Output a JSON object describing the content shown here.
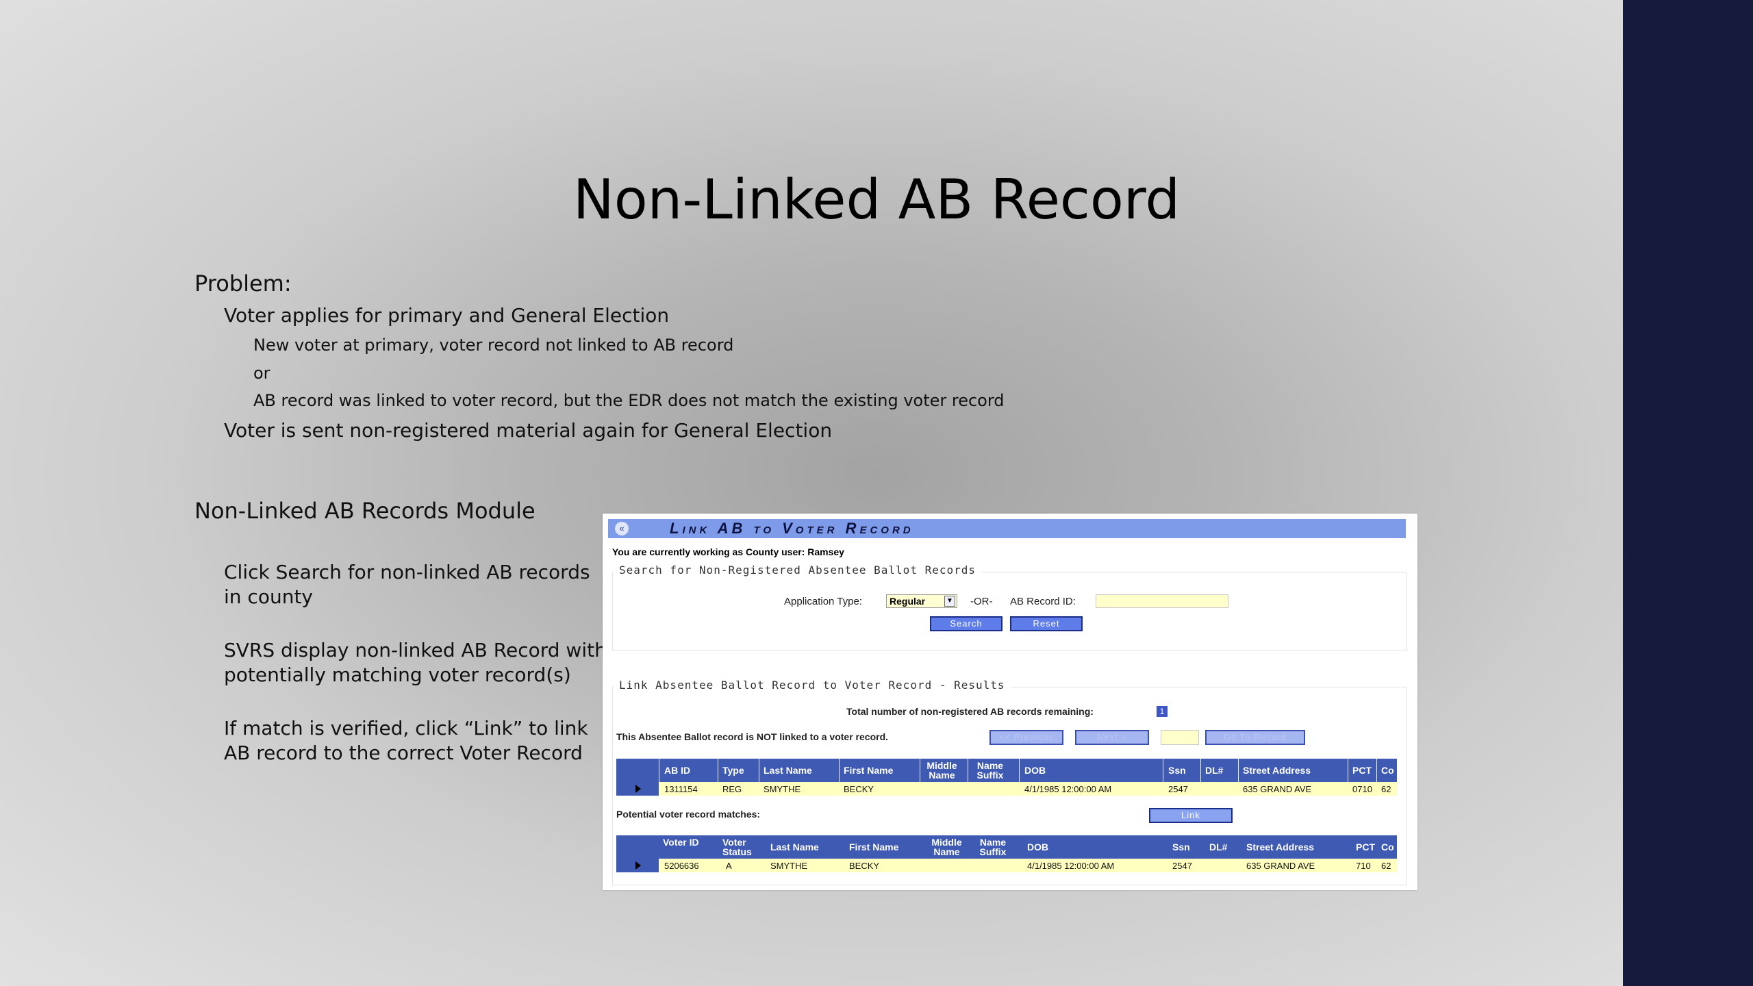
{
  "slide": {
    "title": "Non-Linked AB Record",
    "problem_heading": "Problem:",
    "problem_line1": "Voter applies for primary and General Election",
    "problem_sub1": "New voter at primary, voter record not linked to AB record",
    "problem_or": "or",
    "problem_sub2": "AB record was linked to voter record, but the EDR does not match the existing voter record",
    "problem_line2": "Voter is sent non-registered material again for General Election",
    "module_heading": "Non-Linked AB Records Module",
    "step1": "Click Search for non-linked AB records in county",
    "step2": "SVRS display non-linked AB Record with potentially matching voter record(s)",
    "step3": "If match is verified, click “Link” to link AB record to the correct Voter Record"
  },
  "app": {
    "window_title": "Link AB to Voter Record",
    "collapse_glyph": "«",
    "user_line": "You are currently working as County user: Ramsey",
    "search_section": "Search for Non-Registered Absentee Ballot Records",
    "app_type_label": "Application Type:",
    "app_type_value": "Regular",
    "or_label": "-OR-",
    "ab_record_label": "AB Record ID:",
    "ab_record_value": "",
    "search_btn": "Search",
    "reset_btn": "Reset",
    "results_section": "Link Absentee Ballot Record to Voter Record - Results",
    "total_label": "Total number of non-registered AB records remaining:",
    "total_value": "1",
    "not_linked_msg": "This Absentee Ballot record is NOT linked to a voter record.",
    "prev_btn": "<< Previous",
    "next_btn": "Next >",
    "goto_value": "",
    "goto_btn": "Go To Record",
    "ab_columns": [
      "AB ID",
      "Type",
      "Last Name",
      "First Name",
      "Middle Name",
      "Name Suffix",
      "DOB",
      "Ssn",
      "DL#",
      "Street Address",
      "PCT",
      "Co"
    ],
    "ab_row": [
      "1311154",
      "REG",
      "SMYTHE",
      "BECKY",
      "",
      "",
      "4/1/1985 12:00:00 AM",
      "2547",
      "",
      "635 GRAND AVE",
      "0710",
      "62"
    ],
    "potential_label": "Potential voter record matches:",
    "link_btn": "Link",
    "voter_columns": [
      "Voter ID",
      "Voter Status",
      "Last Name",
      "First Name",
      "Middle Name",
      "Name Suffix",
      "DOB",
      "Ssn",
      "DL#",
      "Street Address",
      "PCT",
      "Co"
    ],
    "voter_row": [
      "5206636",
      "A",
      "SMYTHE",
      "BECKY",
      "",
      "",
      "4/1/1985 12:00:00 AM",
      "2547",
      "",
      "635 GRAND AVE",
      "710",
      "62"
    ]
  }
}
